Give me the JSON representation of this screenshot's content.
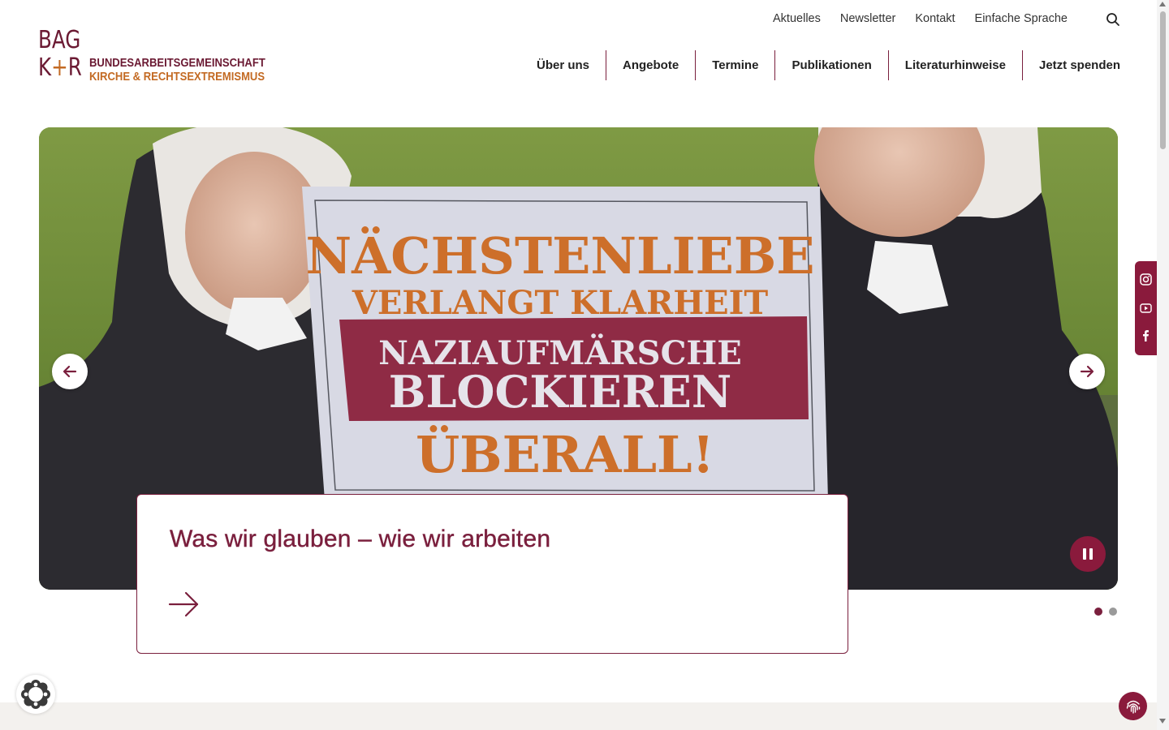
{
  "logo": {
    "line_bag": "BAG",
    "line_k": "K",
    "line_plus": "+",
    "line_r": "R",
    "line1": "BUNDESARBEITSGEMEINSCHAFT",
    "line2": "KIRCHE & RECHTSEXTREMISMUS"
  },
  "top_links": [
    "Aktuelles",
    "Newsletter",
    "Kontakt",
    "Einfache Sprache"
  ],
  "main_nav": [
    "Über uns",
    "Angebote",
    "Termine",
    "Publikationen",
    "Literaturhinweise",
    "Jetzt spenden"
  ],
  "hero": {
    "sign": {
      "line1": "NÄCHSTENLIEBE",
      "line2": "VERLANGT KLARHEIT",
      "line3": "NAZIAUFMÄRSCHE",
      "line4": "BLOCKIEREN",
      "line5": "ÜBERALL!"
    },
    "caption_title": "Was wir glauben – wie wir arbeiten",
    "slide_count": 2,
    "active_slide": 1
  },
  "colors": {
    "brand": "#7a1f3d",
    "accent": "#c36a23"
  },
  "icons": [
    "search-icon",
    "arrow-left-icon",
    "arrow-right-icon",
    "pause-icon",
    "instagram-icon",
    "youtube-icon",
    "facebook-icon",
    "cookie-icon",
    "fingerprint-icon"
  ]
}
